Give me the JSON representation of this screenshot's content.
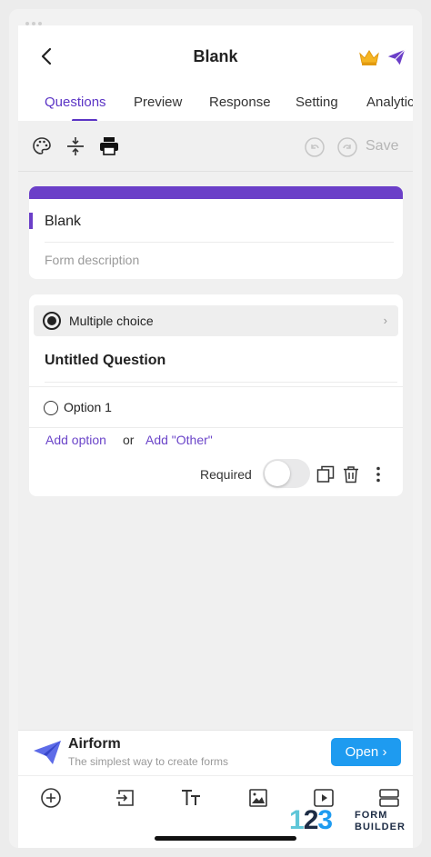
{
  "header": {
    "title": "Blank"
  },
  "tabs": [
    {
      "label": "Questions",
      "active": true
    },
    {
      "label": "Preview",
      "active": false
    },
    {
      "label": "Response",
      "active": false
    },
    {
      "label": "Setting",
      "active": false
    },
    {
      "label": "Analytic",
      "active": false
    }
  ],
  "toolbar": {
    "icons": [
      "palette-icon",
      "spacing-icon",
      "print-icon",
      "undo-icon",
      "redo-icon"
    ],
    "save_label": "Save"
  },
  "form": {
    "title": "Blank",
    "description_placeholder": "Form description"
  },
  "question": {
    "type_label": "Multiple choice",
    "title": "Untitled Question",
    "options": [
      "Option 1"
    ],
    "add_option_label": "Add option",
    "or_label": "or",
    "add_other_label": "Add \"Other\"",
    "required_label": "Required",
    "required_on": false
  },
  "banner": {
    "title": "Airform",
    "subtitle": "The simplest way to create forms",
    "open_label": "Open"
  },
  "bottom_nav": {
    "icons": [
      "add-question-icon",
      "import-icon",
      "text-format-icon",
      "image-icon",
      "video-icon",
      "section-icon"
    ]
  },
  "watermark": {
    "number": "123",
    "line1": "FORM",
    "line2": "BUILDER"
  },
  "colors": {
    "accent": "#5b34c5",
    "banner_button": "#1e9bf0"
  }
}
